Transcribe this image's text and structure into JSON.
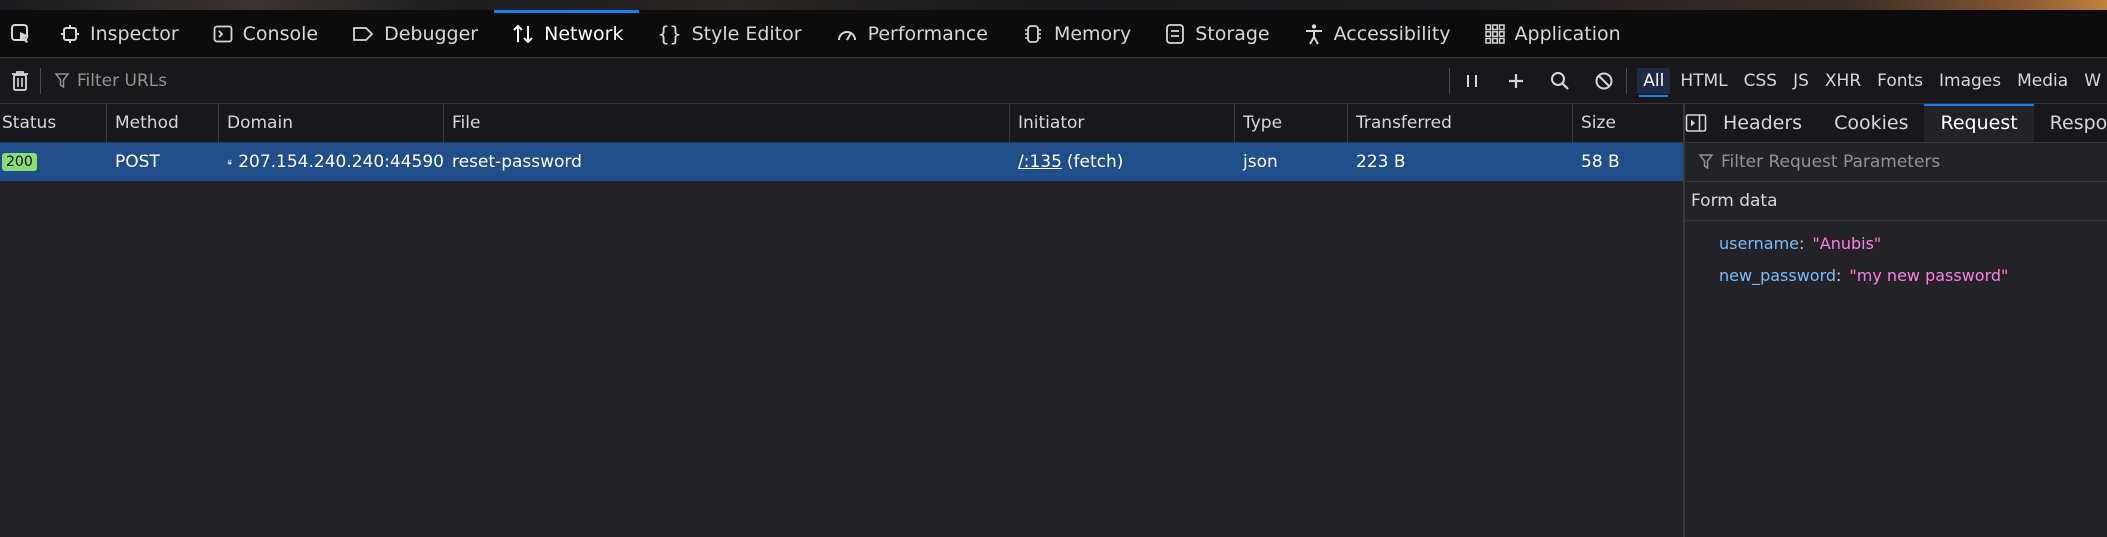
{
  "devtools": {
    "tabs": [
      {
        "label": "Inspector",
        "icon": "inspector-icon"
      },
      {
        "label": "Console",
        "icon": "console-icon"
      },
      {
        "label": "Debugger",
        "icon": "debugger-icon"
      },
      {
        "label": "Network",
        "icon": "network-icon",
        "active": true
      },
      {
        "label": "Style Editor",
        "icon": "braces-icon"
      },
      {
        "label": "Performance",
        "icon": "gauge-icon"
      },
      {
        "label": "Memory",
        "icon": "memory-icon"
      },
      {
        "label": "Storage",
        "icon": "storage-icon"
      },
      {
        "label": "Accessibility",
        "icon": "accessibility-icon"
      },
      {
        "label": "Application",
        "icon": "grid-icon"
      }
    ]
  },
  "network": {
    "filter_placeholder": "Filter URLs",
    "type_filters": [
      "All",
      "HTML",
      "CSS",
      "JS",
      "XHR",
      "Fonts",
      "Images",
      "Media",
      "W"
    ],
    "active_filter": "All"
  },
  "table": {
    "columns": [
      "Status",
      "Method",
      "Domain",
      "File",
      "Initiator",
      "Type",
      "Transferred",
      "Size"
    ],
    "rows": [
      {
        "status": "200",
        "method": "POST",
        "domain": "207.154.240.240:44590",
        "file": "reset-password",
        "initiator_link": "/:135",
        "initiator_kind": "(fetch)",
        "type": "json",
        "transferred": "223 B",
        "size": "58 B"
      }
    ]
  },
  "side_panel": {
    "tabs": [
      "Headers",
      "Cookies",
      "Request",
      "Respo"
    ],
    "active_tab": "Request",
    "filter_placeholder": "Filter Request Parameters",
    "section_title": "Form data",
    "params": [
      {
        "key": "username",
        "value": "\"Anubis\""
      },
      {
        "key": "new_password",
        "value": "\"my new password\""
      }
    ]
  },
  "colors": {
    "accent": "#0a84ff",
    "selected_row": "#204e8a",
    "status_ok": "#86de74",
    "param_key": "#75bfff",
    "param_value": "#ff7de9"
  }
}
